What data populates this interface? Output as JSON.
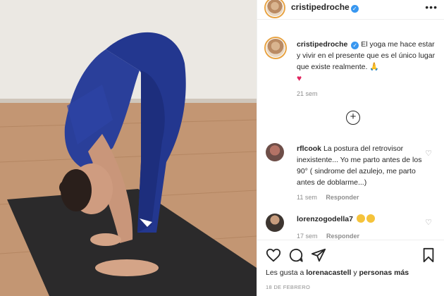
{
  "header": {
    "username": "cristipedroche",
    "verified_icon": "verified-badge-icon",
    "more_icon": "more-options-icon"
  },
  "caption": {
    "username": "cristipedroche",
    "text": "El yoga me hace estar y vivir en el presente que es el único lugar que existe realmente.",
    "emojis": [
      "folded-hands-emoji",
      "red-heart-emoji"
    ],
    "time": "21 sem"
  },
  "load_more_icon": "plus-circle-icon",
  "comments": [
    {
      "username": "rflcook",
      "text": "La postura del retrovisor inexistente... Yo me parto antes de los 90° ( sindrome del azulejo, me parto antes de doblarme...)",
      "time": "11 sem",
      "reply": "Responder"
    },
    {
      "username": "lorenzogodella7",
      "text": "",
      "emojis": [
        "face-emoji",
        "face-emoji"
      ],
      "time": "17 sem",
      "reply": "Responder"
    }
  ],
  "actions": {
    "like_icon": "heart-icon",
    "comment_icon": "comment-icon",
    "share_icon": "share-icon",
    "save_icon": "bookmark-icon"
  },
  "likes": {
    "prefix": "Les gusta a",
    "user": "lorenacastell",
    "connector": "y",
    "others": "personas más"
  },
  "date": "18 DE FEBRERO",
  "colors": {
    "accent": "#3897f0",
    "text": "#262626",
    "muted": "#8e8e8e",
    "heart": "#e0245e"
  }
}
